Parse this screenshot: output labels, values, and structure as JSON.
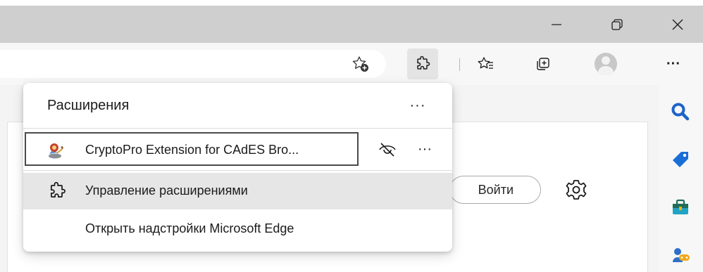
{
  "window": {
    "minimize_icon": "minimize-icon",
    "maximize_icon": "restore-icon",
    "close_icon": "close-icon"
  },
  "toolbar": {
    "favorites_add_icon": "add-favorite-icon",
    "extensions_icon": "extensions-puzzle-icon",
    "favorites_icon": "favorites-icon",
    "collections_icon": "collections-icon",
    "profile_icon": "profile-avatar",
    "more_label": "···"
  },
  "extensions_popup": {
    "title": "Расширения",
    "more_label": "···",
    "extensions": [
      {
        "name": "CryptoPro Extension for CAdES Bro...",
        "icon": "cryptopro-icon",
        "hide_icon": "eye-hidden-icon",
        "more_label": "···"
      }
    ],
    "menu": [
      {
        "label": "Управление расширениями",
        "icon": "extensions-puzzle-icon"
      },
      {
        "label": "Открыть надстройки Microsoft Edge"
      }
    ]
  },
  "page": {
    "login_button": "Войти",
    "settings_icon": "settings-gear-icon"
  },
  "sidebar": {
    "icons": [
      "search-icon",
      "shopping-tag-icon",
      "tools-icon",
      "games-icon"
    ]
  },
  "colors": {
    "titlebar": "#cfcfcf",
    "toolbar": "#f7f7f7",
    "popup_bg": "#ffffff",
    "hover_bg": "#e6e6e6",
    "search_blue": "#1e63c9",
    "tag_blue": "#1a6fd6"
  }
}
